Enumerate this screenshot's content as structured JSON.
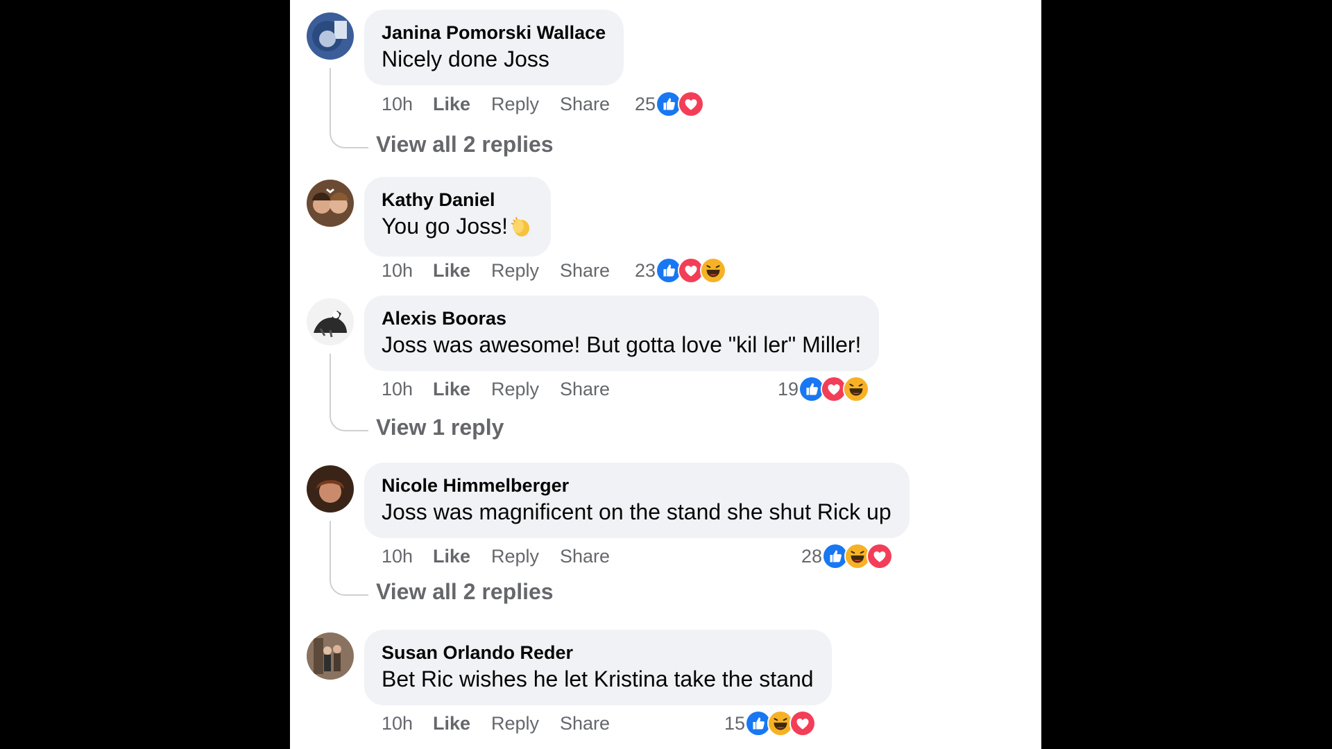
{
  "actions": {
    "like": "Like",
    "reply": "Reply",
    "share": "Share"
  },
  "comments": [
    {
      "author": "Janina Pomorski Wallace",
      "text": "Nicely done Joss",
      "time": "10h",
      "reaction_count": "25",
      "reactions": [
        "like",
        "love"
      ],
      "view_replies": "View all 2 replies"
    },
    {
      "author": "Kathy Daniel",
      "text": "You go Joss!",
      "text_emoji": "clapping-hands-emoji",
      "time": "10h",
      "reaction_count": "23",
      "reactions": [
        "like",
        "love",
        "haha"
      ]
    },
    {
      "author": "Alexis Booras",
      "text": "Joss was awesome! But gotta love \"kil ler\" Miller!",
      "time": "10h",
      "reaction_count": "19",
      "reactions": [
        "like",
        "love",
        "haha"
      ],
      "view_replies": "View 1 reply"
    },
    {
      "author": "Nicole Himmelberger",
      "text": "Joss was magnificent on the stand she shut Rick up",
      "time": "10h",
      "reaction_count": "28",
      "reactions": [
        "like",
        "haha",
        "love"
      ],
      "view_replies": "View all 2 replies"
    },
    {
      "author": "Susan Orlando Reder",
      "text": "Bet Ric wishes he let Kristina take the stand",
      "time": "10h",
      "reaction_count": "15",
      "reactions": [
        "like",
        "haha",
        "love"
      ]
    }
  ],
  "colors": {
    "like": "#1877f2",
    "love": "#f33e58",
    "haha": "#f7b125",
    "bubble": "#f0f2f5",
    "meta_text": "#65676b"
  }
}
